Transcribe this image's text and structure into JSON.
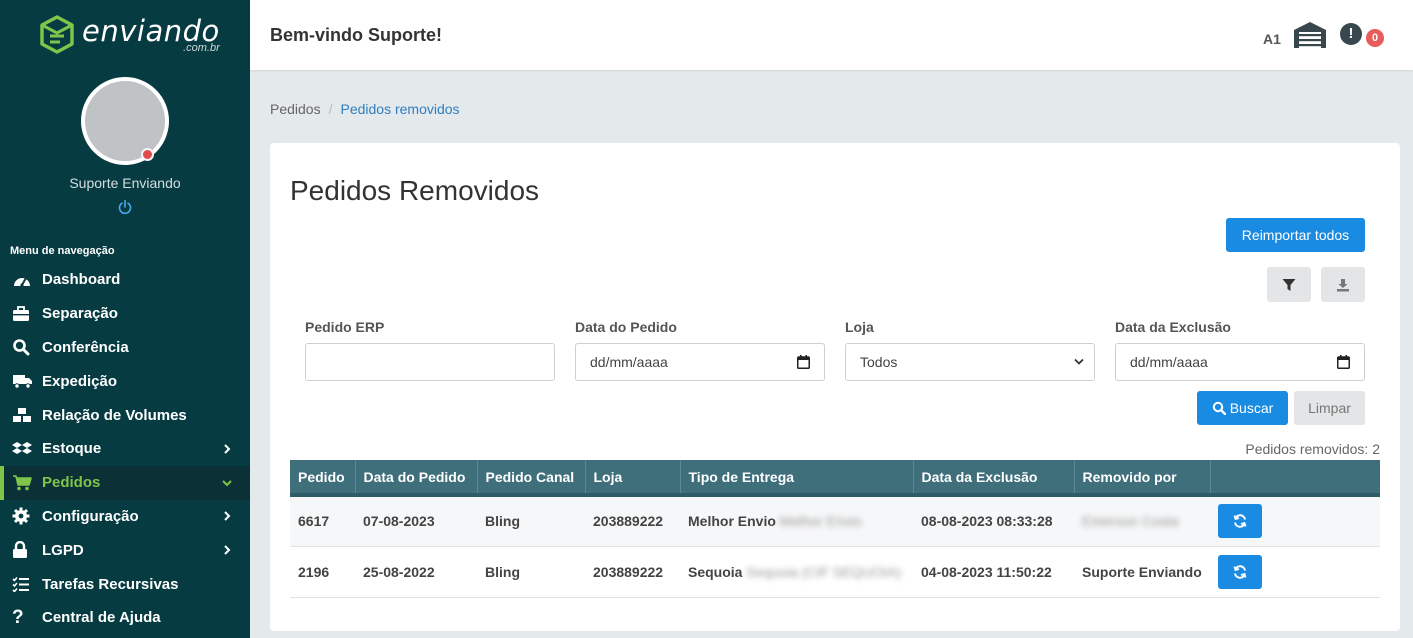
{
  "brand": {
    "name": "enviando",
    "domain": ".com.br",
    "accent": "#7ec54a",
    "sidebar_bg": "#063b41"
  },
  "user": {
    "name": "Suporte Enviando"
  },
  "nav": {
    "heading": "Menu de navegação",
    "items": [
      {
        "label": "Dashboard",
        "icon": "gauge-icon"
      },
      {
        "label": "Separação",
        "icon": "briefcase-icon"
      },
      {
        "label": "Conferência",
        "icon": "search-icon"
      },
      {
        "label": "Expedição",
        "icon": "truck-icon"
      },
      {
        "label": "Relação de Volumes",
        "icon": "boxes-icon"
      },
      {
        "label": "Estoque",
        "icon": "dropbox-icon",
        "has_submenu": true
      },
      {
        "label": "Pedidos",
        "icon": "cart-icon",
        "active": true,
        "expanded": true
      },
      {
        "label": "Configuração",
        "icon": "gear-icon",
        "has_submenu": true
      },
      {
        "label": "LGPD",
        "icon": "lock-icon",
        "has_submenu": true
      },
      {
        "label": "Tarefas Recursivas",
        "icon": "tasks-icon"
      },
      {
        "label": "Central de Ajuda",
        "icon": "question-icon"
      }
    ]
  },
  "topbar": {
    "welcome": "Bem-vindo Suporte!",
    "warehouse_code": "A1",
    "alert_count": "0"
  },
  "breadcrumb": {
    "parent": "Pedidos",
    "current": "Pedidos removidos"
  },
  "page": {
    "title": "Pedidos Removidos",
    "reimport_label": "Reimportar todos",
    "filters": {
      "pedido_erp": {
        "label": "Pedido ERP",
        "value": ""
      },
      "data_pedido": {
        "label": "Data do Pedido",
        "value": "dd/mm/aaaa"
      },
      "loja": {
        "label": "Loja",
        "value": "Todos"
      },
      "data_exclusao": {
        "label": "Data da Exclusão",
        "value": "dd/mm/aaaa"
      }
    },
    "search_label": "Buscar",
    "clear_label": "Limpar",
    "removed_count": "Pedidos removidos: 2"
  },
  "table": {
    "headers": [
      "Pedido",
      "Data do Pedido",
      "Pedido Canal",
      "Loja",
      "Tipo de Entrega",
      "Data da Exclusão",
      "Removido por",
      ""
    ],
    "rows": [
      {
        "pedido": "6617",
        "data": "07-08-2023",
        "canal": "Bling",
        "loja": "203889222",
        "tipo": "Melhor Envio",
        "tipo_blur": "Melhor Envio",
        "exclusao": "08-08-2023 08:33:28",
        "removido": "",
        "removido_blur": "Emerson Costa"
      },
      {
        "pedido": "2196",
        "data": "25-08-2022",
        "canal": "Bling",
        "loja": "203889222",
        "tipo": "Sequoia",
        "tipo_blur": "Sequoia (CIF SEQUOIA)",
        "exclusao": "04-08-2023 11:50:22",
        "removido": "Suporte Enviando",
        "removido_blur": ""
      }
    ]
  }
}
